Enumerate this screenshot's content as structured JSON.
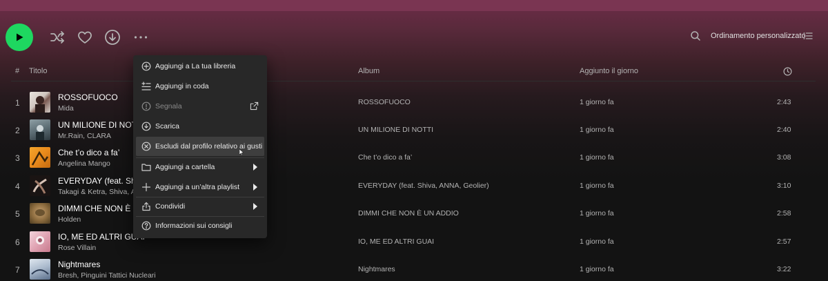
{
  "colors": {
    "accent": "#1ed760",
    "menu_bg": "#282828",
    "menu_hover": "#3e3e3e",
    "header_gradient": "#6d2c48"
  },
  "actionbar": {
    "play_icon": "play-icon",
    "shuffle_icon": "shuffle-icon",
    "like_icon": "heart-icon",
    "download_icon": "download-icon",
    "more_icon": "more-dots-icon",
    "search_icon": "search-icon",
    "sort_label": "Ordinamento personalizzato",
    "sort_icon": "list-icon"
  },
  "table": {
    "headers": {
      "num": "#",
      "title": "Titolo",
      "album": "Album",
      "added": "Aggiunto il giorno",
      "duration_icon": "clock-icon"
    },
    "rows": [
      {
        "num": "1",
        "title": "ROSSOFUOCO",
        "artist": "Mida",
        "album": "ROSSOFUOCO",
        "added": "1 giorno fa",
        "duration": "2:43"
      },
      {
        "num": "2",
        "title": "UN MILIONE DI NOTTI",
        "artist": "Mr.Rain, CLARA",
        "album": "UN MILIONE DI NOTTI",
        "added": "1 giorno fa",
        "duration": "2:40"
      },
      {
        "num": "3",
        "title": "Che t’o dico a fa’",
        "artist": "Angelina Mango",
        "album": "Che t’o dico a fa’",
        "added": "1 giorno fa",
        "duration": "3:08"
      },
      {
        "num": "4",
        "title": "EVERYDAY (feat. Shiv",
        "artist": "Takagi & Ketra, Shiva, A",
        "album": "EVERYDAY (feat. Shiva, ANNA, Geolier)",
        "added": "1 giorno fa",
        "duration": "3:10"
      },
      {
        "num": "5",
        "title": "DIMMI CHE NON È U",
        "artist": "Holden",
        "album": "DIMMI CHE NON È UN ADDIO",
        "added": "1 giorno fa",
        "duration": "2:58"
      },
      {
        "num": "6",
        "title": "IO, ME ED ALTRI GUAI",
        "artist": "Rose Villain",
        "album": "IO, ME ED ALTRI GUAI",
        "added": "1 giorno fa",
        "duration": "2:57"
      },
      {
        "num": "7",
        "title": "Nightmares",
        "artist": "Bresh, Pinguini Tattici Nucleari",
        "album": "Nightmares",
        "added": "1 giorno fa",
        "duration": "3:22"
      }
    ]
  },
  "context_menu": {
    "items": [
      {
        "label": "Aggiungi a La tua libreria",
        "icon": "plus-circle-icon"
      },
      {
        "label": "Aggiungi in coda",
        "icon": "add-to-queue-icon"
      },
      {
        "label": "Segnala",
        "icon": "report-icon",
        "disabled": true,
        "trailing_icon": "external-link-icon"
      },
      {
        "label": "Scarica",
        "icon": "download-circle-icon"
      },
      {
        "label": "Escludi dal profilo relativo ai gusti",
        "icon": "exclude-icon",
        "hover": true
      },
      {
        "label": "Aggiungi a cartella",
        "icon": "folder-icon",
        "submenu": true
      },
      {
        "label": "Aggiungi a un’altra playlist",
        "icon": "plus-icon",
        "submenu": true
      },
      {
        "label": "Condividi",
        "icon": "share-icon",
        "submenu": true
      },
      {
        "label": "Informazioni sui consigli",
        "icon": "help-circle-icon"
      }
    ]
  }
}
